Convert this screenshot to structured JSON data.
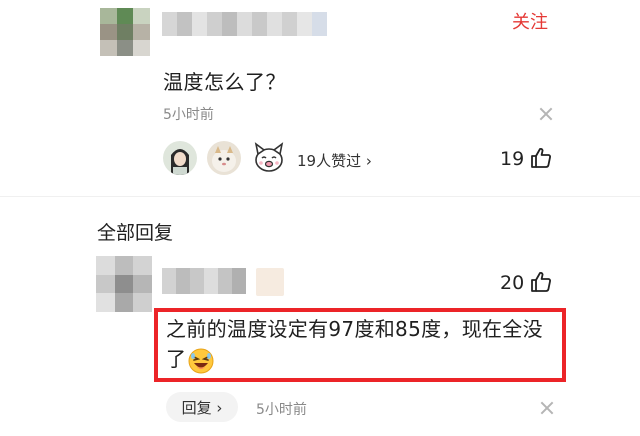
{
  "header": {
    "follow_label": "关注"
  },
  "post": {
    "text": "温度怎么了？",
    "time": "5小时前",
    "likers_text": "19人赞过 ›",
    "like_count": "19"
  },
  "replies_section": {
    "heading": "全部回复"
  },
  "reply": {
    "like_count": "20",
    "text": "之前的温度设定有97度和85度，现在全没了",
    "reply_button_label": "回复 ›",
    "time": "5小时前"
  },
  "colors": {
    "accent_red": "#e53935",
    "highlight_border": "#ec2428",
    "muted_text": "#8a8a8a"
  },
  "icons": {
    "like": "thumbs-up-icon",
    "close": "close-icon",
    "emoji": "laughing-emoji-icon"
  }
}
